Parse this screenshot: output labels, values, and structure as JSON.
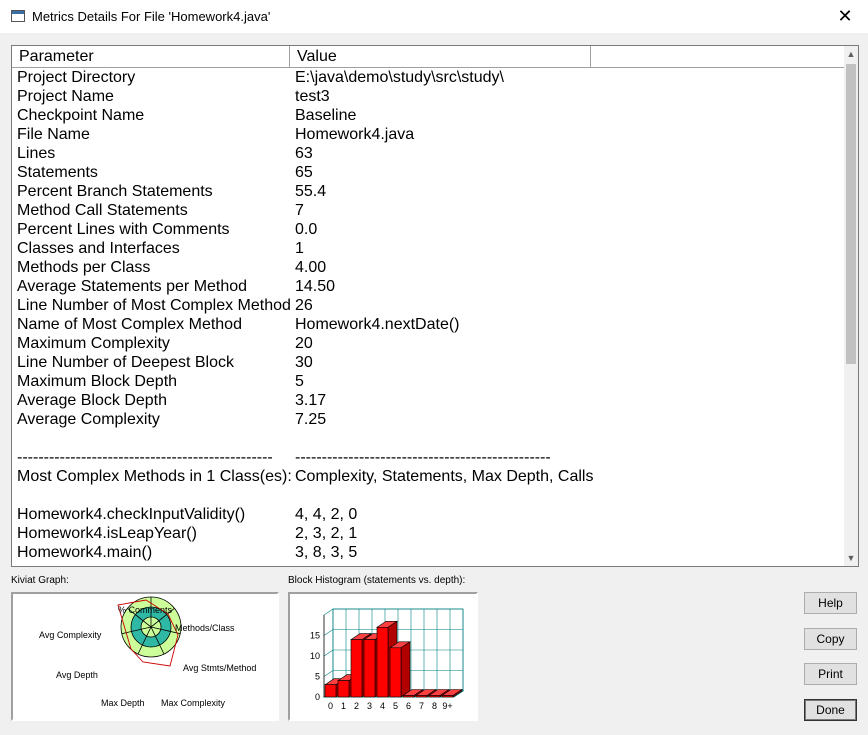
{
  "window": {
    "title": "Metrics Details For File 'Homework4.java'",
    "close_glyph": "✕"
  },
  "table": {
    "headers": [
      "Parameter",
      "Value"
    ],
    "rows": [
      [
        "Project Directory",
        "E:\\java\\demo\\study\\src\\study\\"
      ],
      [
        "Project Name",
        "test3"
      ],
      [
        "Checkpoint Name",
        "Baseline"
      ],
      [
        "File Name",
        "Homework4.java"
      ],
      [
        "Lines",
        "63"
      ],
      [
        "Statements",
        "65"
      ],
      [
        "Percent Branch Statements",
        "55.4"
      ],
      [
        "Method Call Statements",
        "7"
      ],
      [
        "Percent Lines with Comments",
        "0.0"
      ],
      [
        "Classes and Interfaces",
        "1"
      ],
      [
        "Methods per Class",
        "4.00"
      ],
      [
        "Average Statements per Method",
        "14.50"
      ],
      [
        "Line Number of Most Complex Method",
        "26"
      ],
      [
        "Name of Most Complex Method",
        "Homework4.nextDate()"
      ],
      [
        "Maximum Complexity",
        "20"
      ],
      [
        "Line Number of Deepest Block",
        "30"
      ],
      [
        "Maximum Block Depth",
        "5"
      ],
      [
        "Average Block Depth",
        "3.17"
      ],
      [
        "Average Complexity",
        "7.25"
      ],
      [
        "",
        ""
      ],
      [
        "------------------------------------------------",
        "------------------------------------------------"
      ],
      [
        "Most Complex Methods in 1 Class(es):",
        "Complexity, Statements, Max Depth, Calls"
      ],
      [
        "",
        ""
      ],
      [
        "Homework4.checkInputValidity()",
        "4, 4, 2, 0"
      ],
      [
        "Homework4.isLeapYear()",
        "2, 3, 2, 1"
      ],
      [
        "Homework4.main()",
        "3, 8, 3, 5"
      ]
    ]
  },
  "kiviat": {
    "label": "Kiviat Graph:",
    "axes": [
      "% Comments",
      "Methods/Class",
      "Avg Stmts/Method",
      "Max Complexity",
      "Max Depth",
      "Avg Depth",
      "Avg Complexity"
    ]
  },
  "histogram": {
    "label": "Block Histogram (statements vs. depth):",
    "y_ticks": [
      "15",
      "10",
      "5",
      "0"
    ],
    "x_ticks": [
      "0",
      "1",
      "2",
      "3",
      "4",
      "5",
      "6",
      "7",
      "8",
      "9+"
    ],
    "values": [
      3,
      4,
      14,
      14,
      17,
      12,
      0,
      0,
      0,
      0
    ],
    "ymax": 20
  },
  "buttons": {
    "help": "Help",
    "copy": "Copy",
    "print": "Print",
    "done": "Done"
  },
  "scroll": {
    "up": "▲",
    "down": "▼"
  },
  "colors": {
    "bar": "#ff0000",
    "kiviat_outer": "#ccff99",
    "kiviat_inner": "#2fb8a3",
    "grid": "#008080"
  }
}
